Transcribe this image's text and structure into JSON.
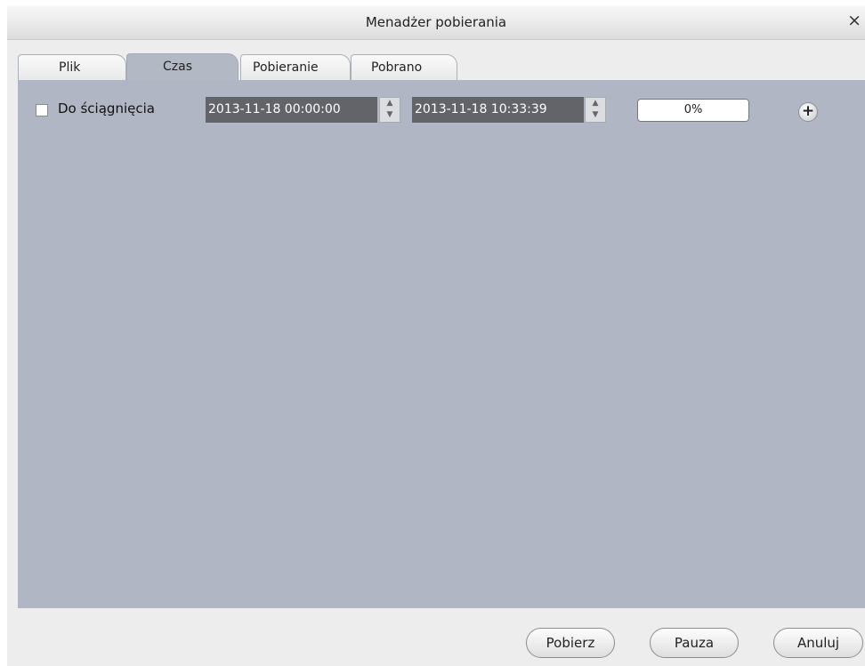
{
  "window": {
    "title": "Menadżer pobierania",
    "close_glyph": "×"
  },
  "tabs": [
    {
      "label": "Plik",
      "active": false
    },
    {
      "label": "Czas",
      "active": true
    },
    {
      "label": "Pobieranie",
      "active": false
    },
    {
      "label": "Pobrano",
      "active": false
    }
  ],
  "time_row": {
    "checkbox_label": "Do ściągnięcia",
    "checked": false,
    "start_time": "2013-11-18 00:00:00",
    "end_time": "2013-11-18 10:33:39",
    "progress_text": "0%",
    "progress_value": 0,
    "add_glyph": "+"
  },
  "buttons": {
    "download": "Pobierz",
    "pause": "Pauza",
    "cancel": "Anuluj"
  },
  "icons": {
    "close": "close-icon",
    "add": "plus-circle-icon",
    "spin_up": "arrow-up-icon",
    "spin_down": "arrow-down-icon"
  }
}
